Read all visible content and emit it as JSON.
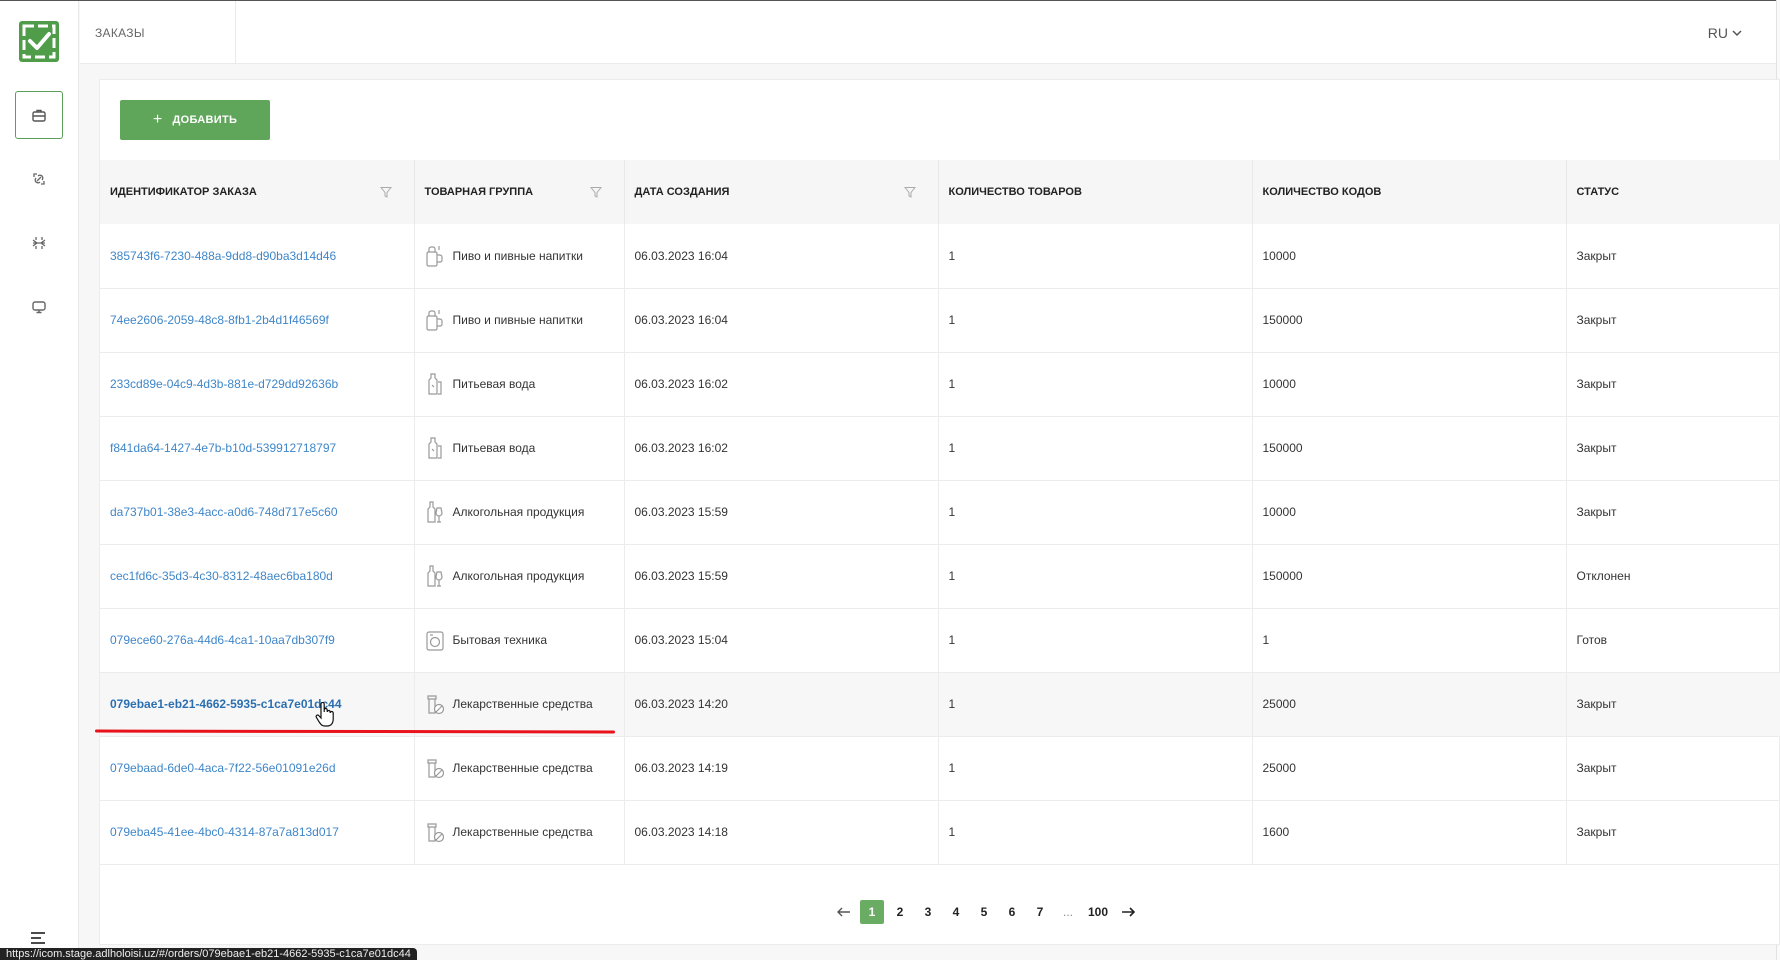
{
  "header": {
    "title": "ЗАКАЗЫ",
    "language": "RU"
  },
  "sidebar": {
    "logo": "checkmark-logo",
    "items": [
      {
        "name": "orders",
        "icon": "briefcase-icon",
        "active": true
      },
      {
        "name": "link",
        "icon": "link-icon",
        "active": false
      },
      {
        "name": "scan",
        "icon": "scan-icon",
        "active": false
      },
      {
        "name": "display",
        "icon": "monitor-icon",
        "active": false
      }
    ],
    "menu_icon": "menu-icon"
  },
  "toolbar": {
    "add_label": "ДОБАВИТЬ",
    "add_icon": "+"
  },
  "table": {
    "columns": [
      {
        "label": "ИДЕНТИФИКАТОР ЗАКАЗА",
        "filter": true
      },
      {
        "label": "ТОВАРНАЯ ГРУППА",
        "filter": true
      },
      {
        "label": "ДАТА СОЗДАНИЯ",
        "filter": true
      },
      {
        "label": "КОЛИЧЕСТВО ТОВАРОВ",
        "filter": false
      },
      {
        "label": "КОЛИЧЕСТВО КОДОВ",
        "filter": false
      },
      {
        "label": "СТАТУС",
        "filter": false
      }
    ],
    "rows": [
      {
        "id": "385743f6-7230-488a-9dd8-d90ba3d14d46",
        "group": "Пиво и пивные напитки",
        "group_icon": "beer-icon",
        "date": "06.03.2023 16:04",
        "items": "1",
        "codes": "10000",
        "status": "Закрыт"
      },
      {
        "id": "74ee2606-2059-48c8-8fb1-2b4d1f46569f",
        "group": "Пиво и пивные напитки",
        "group_icon": "beer-icon",
        "date": "06.03.2023 16:04",
        "items": "1",
        "codes": "150000",
        "status": "Закрыт"
      },
      {
        "id": "233cd89e-04c9-4d3b-881e-d729dd92636b",
        "group": "Питьевая вода",
        "group_icon": "water-icon",
        "date": "06.03.2023 16:02",
        "items": "1",
        "codes": "10000",
        "status": "Закрыт"
      },
      {
        "id": "f841da64-1427-4e7b-b10d-539912718797",
        "group": "Питьевая вода",
        "group_icon": "water-icon",
        "date": "06.03.2023 16:02",
        "items": "1",
        "codes": "150000",
        "status": "Закрыт"
      },
      {
        "id": "da737b01-38e3-4acc-a0d6-748d717e5c60",
        "group": "Алкогольная продукция",
        "group_icon": "alcohol-icon",
        "date": "06.03.2023 15:59",
        "items": "1",
        "codes": "10000",
        "status": "Закрыт"
      },
      {
        "id": "cec1fd6c-35d3-4c30-8312-48aec6ba180d",
        "group": "Алкогольная продукция",
        "group_icon": "alcohol-icon",
        "date": "06.03.2023 15:59",
        "items": "1",
        "codes": "150000",
        "status": "Отклонен"
      },
      {
        "id": "079ece60-276a-44d6-4ca1-10aa7db307f9",
        "group": "Бытовая техника",
        "group_icon": "appliance-icon",
        "date": "06.03.2023 15:04",
        "items": "1",
        "codes": "1",
        "status": "Готов"
      },
      {
        "id": "079ebae1-eb21-4662-5935-c1ca7e01dc44",
        "group": "Лекарственные средства",
        "group_icon": "medicine-icon",
        "date": "06.03.2023 14:20",
        "items": "1",
        "codes": "25000",
        "status": "Закрыт",
        "hover": true
      },
      {
        "id": "079ebaad-6de0-4aca-7f22-56e01091e26d",
        "group": "Лекарственные средства",
        "group_icon": "medicine-icon",
        "date": "06.03.2023 14:19",
        "items": "1",
        "codes": "25000",
        "status": "Закрыт"
      },
      {
        "id": "079eba45-41ee-4bc0-4314-87a7a813d017",
        "group": "Лекарственные средства",
        "group_icon": "medicine-icon",
        "date": "06.03.2023 14:18",
        "items": "1",
        "codes": "1600",
        "status": "Закрыт"
      }
    ]
  },
  "pagination": {
    "prev_icon": "arrow-left-icon",
    "next_icon": "arrow-right-icon",
    "pages": [
      "1",
      "2",
      "3",
      "4",
      "5",
      "6",
      "7",
      "...",
      "100"
    ],
    "current": "1"
  },
  "statusbar": {
    "url": "https://icom.stage.adlholoisi.uz/#/orders/079ebae1-eb21-4662-5935-c1ca7e01dc44"
  },
  "colors": {
    "accent": "#5fa65a",
    "link": "#3f86c8",
    "annotation": "#e8131a"
  }
}
